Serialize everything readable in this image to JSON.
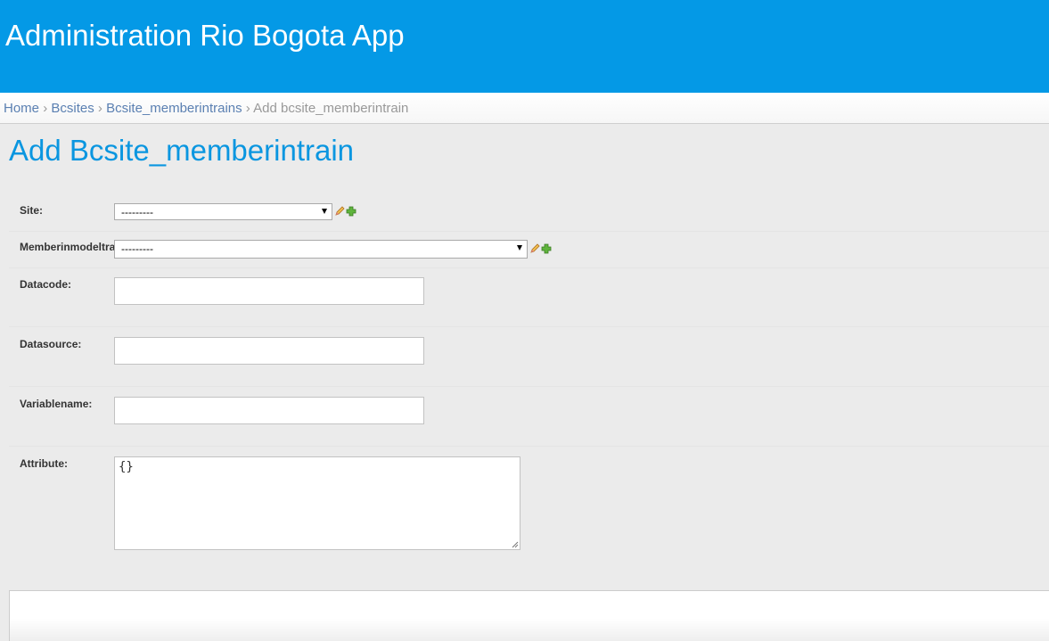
{
  "header": {
    "title": "Administration Rio Bogota App"
  },
  "breadcrumbs": {
    "items": [
      "Home",
      "Bcsites",
      "Bcsite_memberintrains"
    ],
    "separator": "›",
    "current": "Add bcsite_memberintrain"
  },
  "page": {
    "title": "Add Bcsite_memberintrain"
  },
  "form": {
    "site": {
      "label": "Site:",
      "value": "---------"
    },
    "memberinmodeltrain": {
      "label": "Memberinmodeltra",
      "value": "---------"
    },
    "datacode": {
      "label": "Datacode:",
      "value": ""
    },
    "datasource": {
      "label": "Datasource:",
      "value": ""
    },
    "variablename": {
      "label": "Variablename:",
      "value": ""
    },
    "attribute": {
      "label": "Attribute:",
      "value": "{}"
    }
  },
  "icons": {
    "change": "pencil-icon",
    "add": "plus-icon"
  },
  "colors": {
    "header": "#0499e6",
    "title": "#0a96e0",
    "link": "#5b80b2",
    "background": "#ebebeb"
  }
}
